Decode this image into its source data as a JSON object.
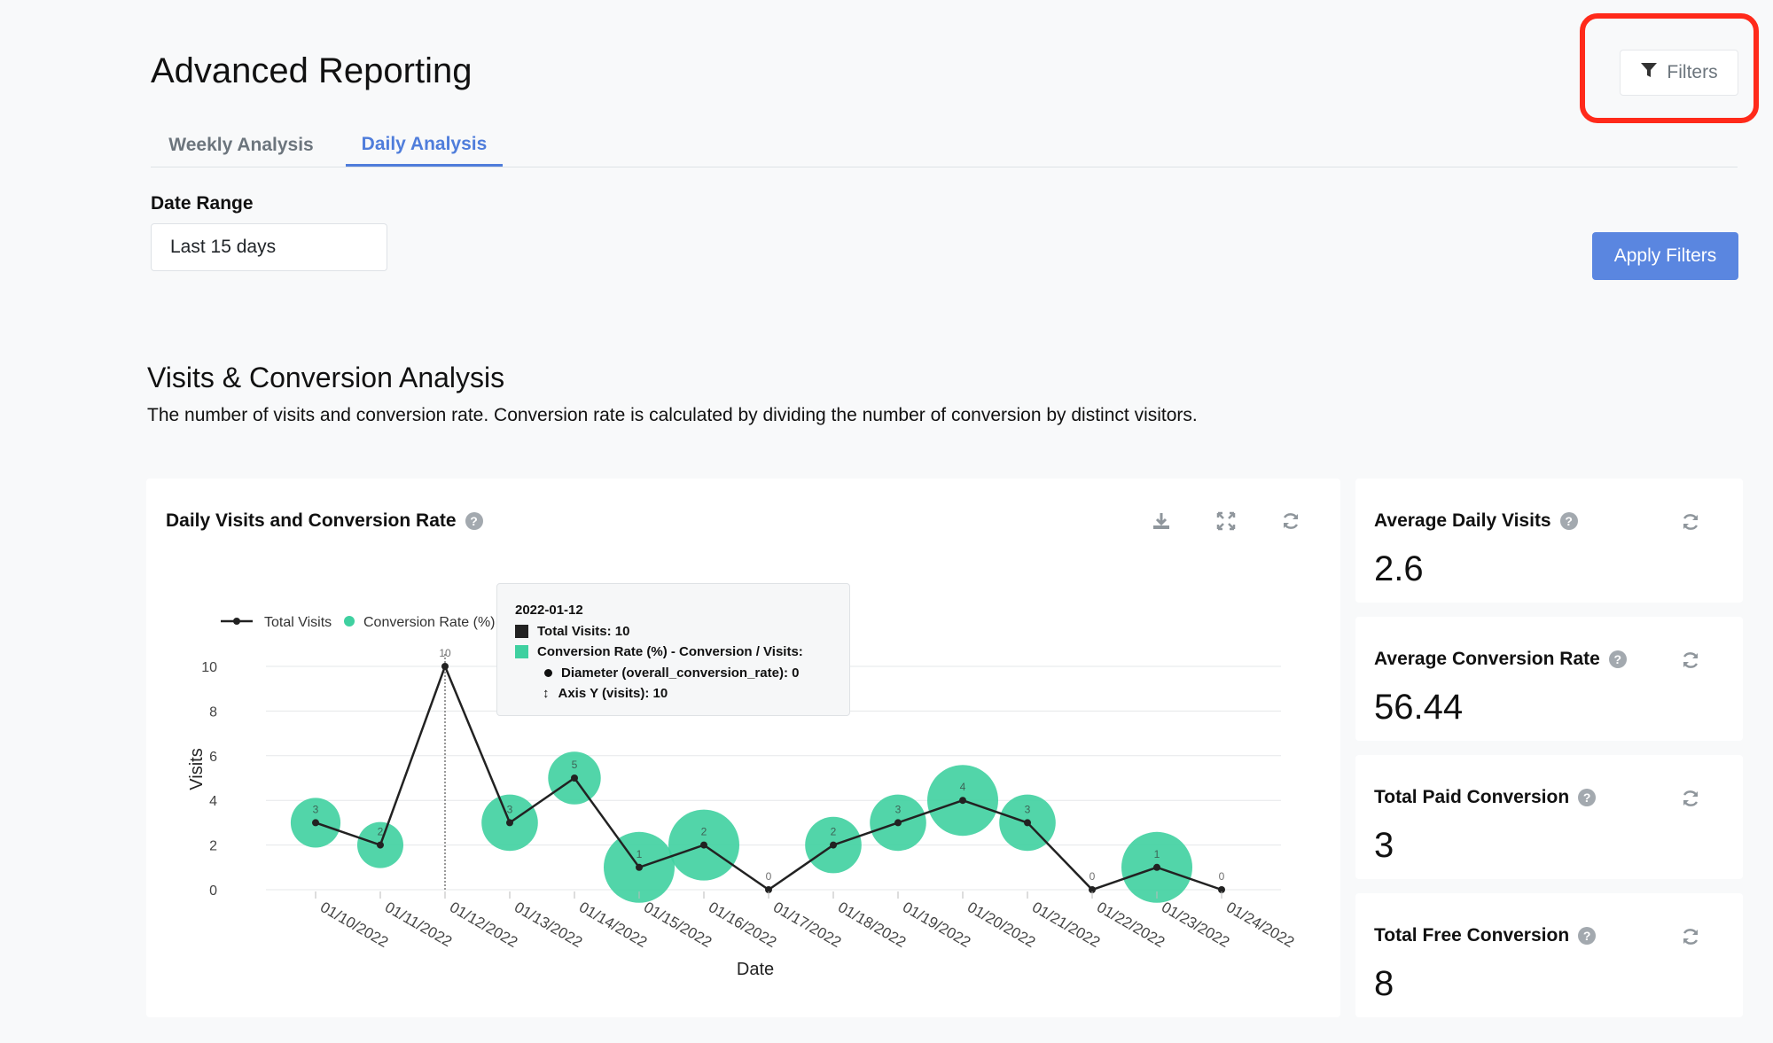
{
  "header": {
    "title": "Advanced Reporting",
    "filters_label": "Filters"
  },
  "tabs": [
    {
      "label": "Weekly Analysis"
    },
    {
      "label": "Daily Analysis"
    }
  ],
  "date_range": {
    "label": "Date Range",
    "value": "Last 15 days"
  },
  "apply_label": "Apply Filters",
  "section": {
    "title": "Visits & Conversion Analysis",
    "description": "The number of visits and conversion rate. Conversion rate is calculated by dividing the number of conversion by distinct visitors."
  },
  "chart_card": {
    "title": "Daily Visits and Conversion Rate"
  },
  "tooltip": {
    "date": "2022-01-12",
    "total_visits": "Total Visits: 10",
    "conversion_header": "Conversion Rate (%) - Conversion / Visits:",
    "diameter": "Diameter (overall_conversion_rate): 0",
    "axis_y": "Axis Y (visits): 10"
  },
  "stats": [
    {
      "title": "Average Daily Visits",
      "value": "2.6"
    },
    {
      "title": "Average Conversion Rate",
      "value": "56.44"
    },
    {
      "title": "Total Paid Conversion",
      "value": "3"
    },
    {
      "title": "Total Free Conversion",
      "value": "8"
    }
  ],
  "icons": [
    "filter-icon",
    "download-icon",
    "fullscreen-icon",
    "refresh-icon",
    "help-icon"
  ],
  "colors": {
    "accent": "#4f7ddb",
    "bubble": "#3fd0a0",
    "line": "#222222",
    "highlight": "#ff2a1a"
  },
  "chart_data": {
    "type": "line",
    "title": "Daily Visits and Conversion Rate",
    "xlabel": "Date",
    "ylabel": "Visits",
    "ylim": [
      0,
      10
    ],
    "yticks": [
      0,
      2,
      4,
      6,
      8,
      10
    ],
    "grid": true,
    "legend_position": "top-left",
    "categories": [
      "01/10/2022",
      "01/11/2022",
      "01/12/2022",
      "01/13/2022",
      "01/14/2022",
      "01/15/2022",
      "01/16/2022",
      "01/17/2022",
      "01/18/2022",
      "01/19/2022",
      "01/20/2022",
      "01/21/2022",
      "01/22/2022",
      "01/23/2022",
      "01/24/2022"
    ],
    "series": [
      {
        "name": "Total Visits",
        "values": [
          3,
          2,
          10,
          3,
          5,
          1,
          2,
          0,
          2,
          3,
          4,
          3,
          0,
          1,
          0
        ]
      },
      {
        "name": "Conversion Rate (%)",
        "values": [
          33,
          25,
          0,
          50,
          40,
          100,
          100,
          0,
          50,
          50,
          100,
          50,
          0,
          100,
          0
        ]
      }
    ],
    "point_labels": [
      "3",
      "2",
      "10",
      "3",
      "5",
      "1",
      "2",
      "0",
      "2",
      "3",
      "4",
      "3",
      "0",
      "1",
      "0"
    ]
  }
}
